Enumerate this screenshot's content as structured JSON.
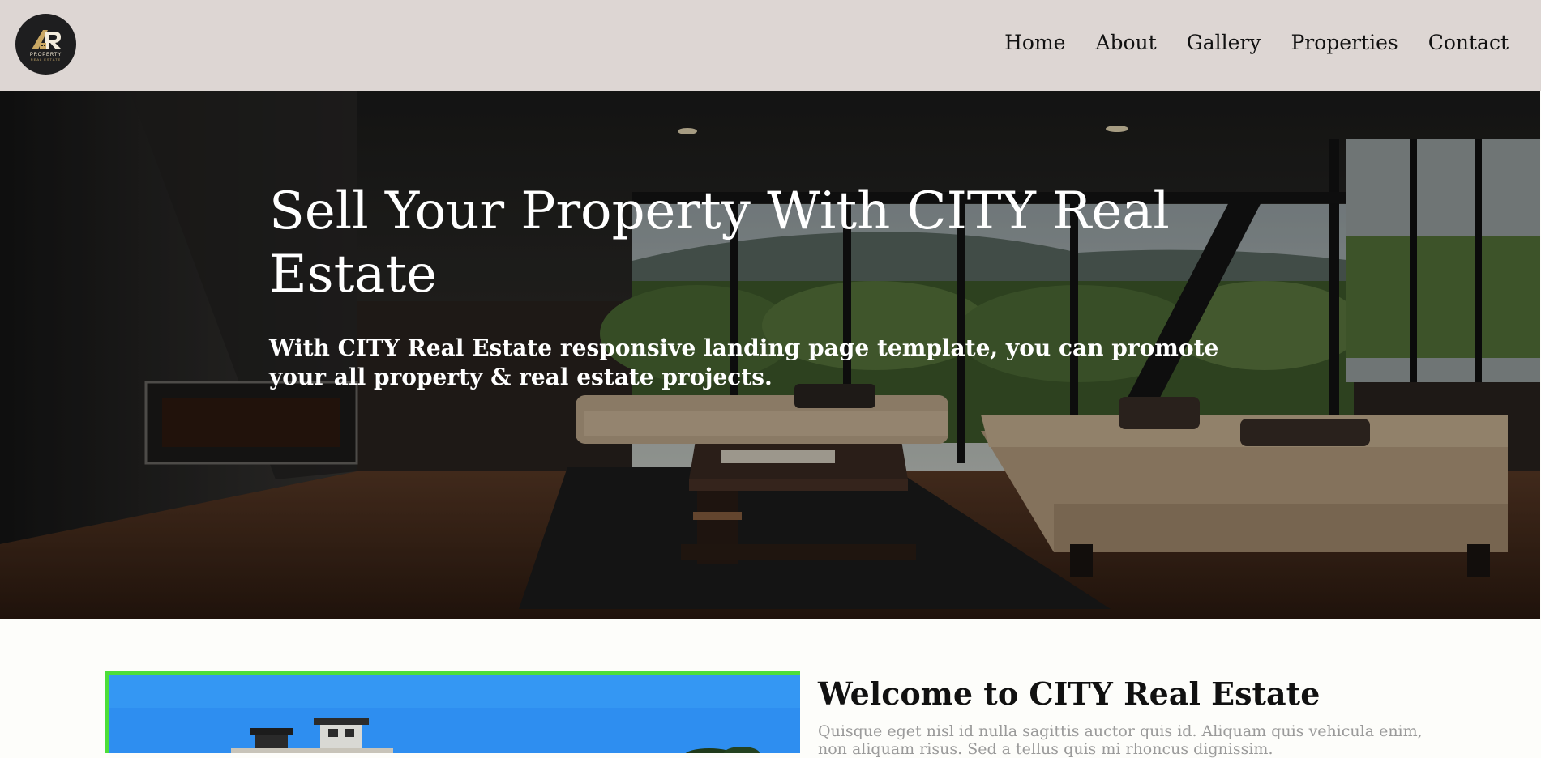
{
  "brand": {
    "logo_icon": "ar-house-logo-icon",
    "line1": "PROPERTY",
    "line2": "REAL ESTATE"
  },
  "nav": {
    "items": [
      {
        "label": "Home"
      },
      {
        "label": "About"
      },
      {
        "label": "Gallery"
      },
      {
        "label": "Properties"
      },
      {
        "label": "Contact"
      }
    ]
  },
  "hero": {
    "title": "Sell Your Property With CITY Real Estate",
    "subtitle": "With CITY Real Estate responsive landing page template, you can promote your all property & real estate projects."
  },
  "welcome": {
    "title": "Welcome to CITY Real Estate",
    "text": "Quisque eget nisl id nulla sagittis auctor quis id. Aliquam quis vehicula enim, non aliquam risus. Sed a tellus quis mi rhoncus dignissim."
  },
  "colors": {
    "topbar": "#ddd6d3",
    "accent_border": "#4cde3a",
    "logo_bg": "#1e1e1f",
    "logo_gold": "#d5b77c"
  }
}
